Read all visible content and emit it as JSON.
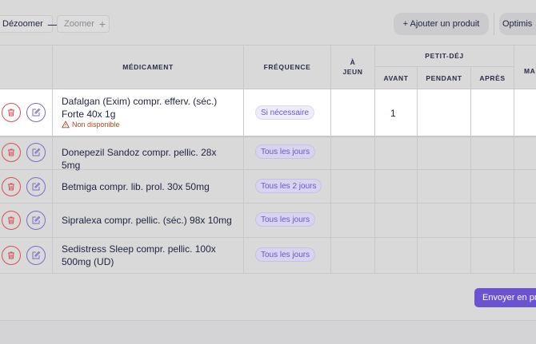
{
  "toolbar": {
    "zoom_out_label": "Dézoomer",
    "zoom_out_symbol": "—",
    "zoom_in_label": "Zoomer",
    "zoom_in_symbol": "+",
    "add_product_label": "+ Ajouter un produit",
    "optimise_label": "Optimis"
  },
  "table": {
    "headers": {
      "medicament": "MÉDICAMENT",
      "frequence": "FRÉQUENCE",
      "a_jeun_1": "À",
      "a_jeun_2": "JEUN",
      "petit_dej": "PETIT-DÉJ",
      "avant": "AVANT",
      "pendant": "PENDANT",
      "apres": "APRÈS",
      "next_col": "MA"
    },
    "rows": [
      {
        "name": "Dafalgan (Exim) compr. efferv. (séc.) Forte 40x 1g",
        "warning": "Non disponible",
        "frequency": "Si nécessaire",
        "avant": "1"
      },
      {
        "name": "Donepezil Sandoz compr. pellic. 28x 5mg",
        "frequency": "Tous les jours"
      },
      {
        "name": "Betmiga compr. lib. prol. 30x 50mg",
        "frequency": "Tous les 2 jours"
      },
      {
        "name": "Sipralexa compr. pellic. (séc.) 98x 10mg",
        "frequency": "Tous les jours"
      },
      {
        "name": "Sedistress Sleep compr. pellic. 100x 500mg (UD)",
        "frequency": "Tous les jours"
      }
    ]
  },
  "footer": {
    "send_label": "Envoyer en pro"
  },
  "colors": {
    "accent": "#6b52cf",
    "danger": "#d55050",
    "warning": "#b5471e"
  }
}
